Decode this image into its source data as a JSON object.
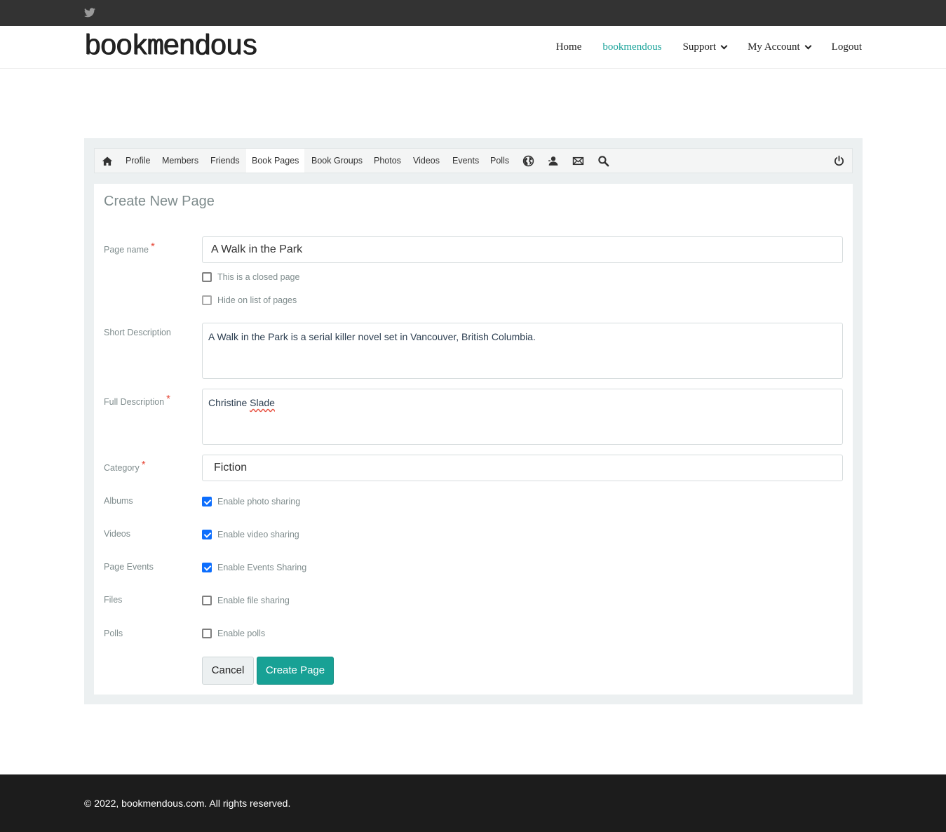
{
  "topbar": {
    "icon": "twitter-icon"
  },
  "header": {
    "logo": "bookmendous",
    "nav": [
      {
        "label": "Home"
      },
      {
        "label": "bookmendous",
        "active": true
      },
      {
        "label": "Support",
        "dropdown": true
      },
      {
        "label": "My Account",
        "dropdown": true
      },
      {
        "label": "Logout"
      }
    ]
  },
  "subnav": {
    "home_icon": "home-icon",
    "tabs": [
      "Profile",
      "Members",
      "Friends",
      "Book Pages",
      "Book Groups",
      "Photos",
      "Videos",
      "Events",
      "Polls"
    ],
    "active_tab": "Book Pages",
    "icons": [
      "globe-icon",
      "user-icon",
      "mail-icon",
      "search-icon",
      "power-icon"
    ]
  },
  "form": {
    "title": "Create New Page",
    "page_name": {
      "label": "Page name",
      "value": "A Walk in the Park"
    },
    "closed_page": {
      "label": "This is a closed page",
      "checked": false
    },
    "hide_list": {
      "label": "Hide on list of pages",
      "checked": false
    },
    "short_description": {
      "label": "Short Description",
      "value": "A Walk in the Park is a serial killer novel set in Vancouver, British Columbia."
    },
    "full_description": {
      "label": "Full Description",
      "value_first": "Christine ",
      "value_misspelled": "Slade"
    },
    "category": {
      "label": "Category",
      "value": "Fiction"
    },
    "albums": {
      "label": "Albums",
      "option": "Enable photo sharing",
      "checked": true
    },
    "videos": {
      "label": "Videos",
      "option": "Enable video sharing",
      "checked": true
    },
    "page_events": {
      "label": "Page Events",
      "option": "Enable Events Sharing",
      "checked": true
    },
    "files": {
      "label": "Files",
      "option": "Enable file sharing",
      "checked": false
    },
    "polls": {
      "label": "Polls",
      "option": "Enable polls",
      "checked": false
    },
    "cancel_label": "Cancel",
    "create_label": "Create Page",
    "required_mark": "*"
  },
  "footer": {
    "copyright": "© 2022, bookmendous.com. All rights reserved."
  },
  "colors": {
    "accent": "#1aa39a",
    "button": "#18a195",
    "checkbox": "#0d6efd",
    "topbar": "#333333",
    "footer": "#1c1c1c"
  }
}
